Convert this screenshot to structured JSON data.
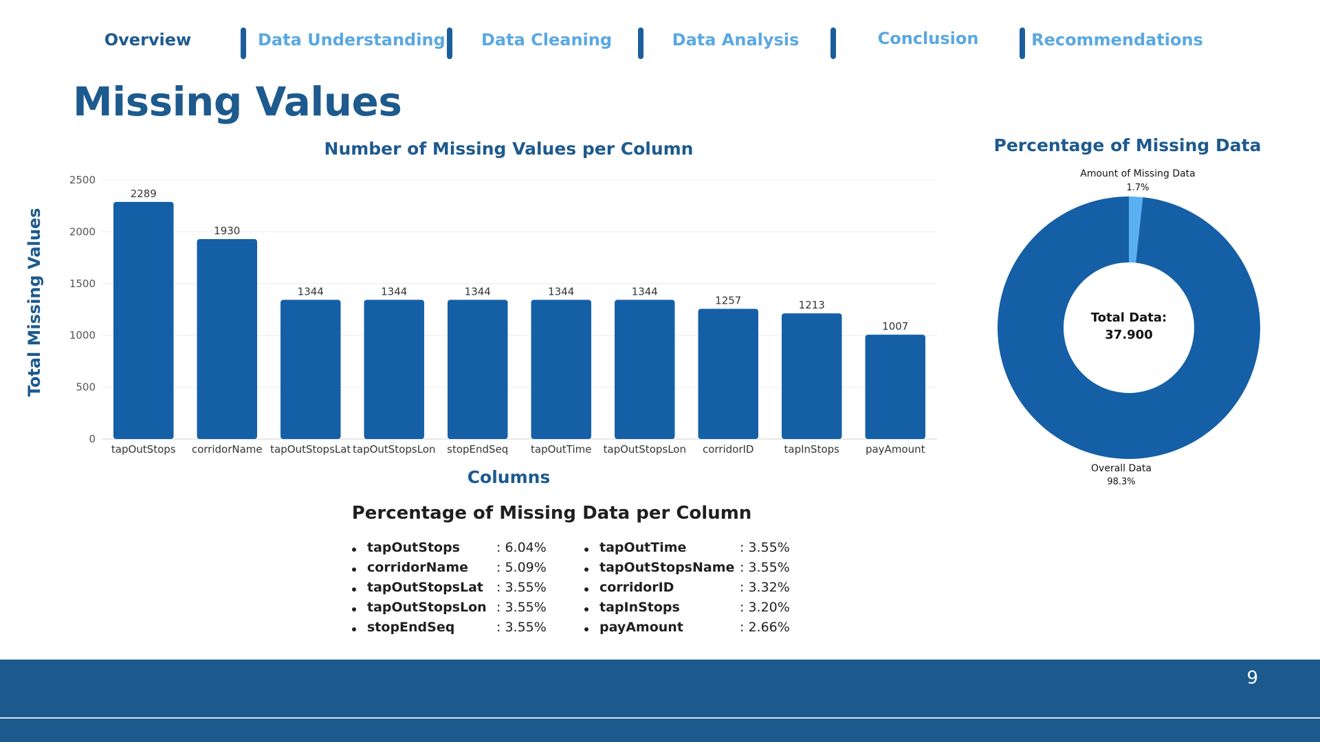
{
  "nav": {
    "items": [
      {
        "label": "Overview",
        "active": true
      },
      {
        "label": "Data Understanding",
        "active": false
      },
      {
        "label": "Data Cleaning",
        "active": false
      },
      {
        "label": "Data Analysis",
        "active": false
      },
      {
        "label": "Conclusion",
        "active": false
      },
      {
        "label": "Recommendations",
        "active": false
      }
    ]
  },
  "page": {
    "title": "Missing Values",
    "page_number": "9"
  },
  "colors": {
    "dark_blue": "#1d5a8e",
    "bar_blue": "#155fa6",
    "light_blue": "#5aa8e0",
    "donut_highlight": "#5ab0f2",
    "footer": "#1c5a8e"
  },
  "chart_data": [
    {
      "type": "bar",
      "title": "Number of Missing Values per Column",
      "xlabel": "Columns",
      "ylabel": "Total Missing Values",
      "categories": [
        "tapOutStops",
        "corridorName",
        "tapOutStopsLat",
        "tapOutStopsLon",
        "stopEndSeq",
        "tapOutTime",
        "tapOutStopsLon",
        "corridorID",
        "tapInStops",
        "payAmount"
      ],
      "values": [
        2289,
        1930,
        1344,
        1344,
        1344,
        1344,
        1344,
        1257,
        1213,
        1007
      ],
      "value_labels": [
        "2289",
        "1930",
        "1344",
        "1344",
        "1344",
        "1344",
        "1344",
        "1257",
        "1213",
        "1007"
      ],
      "ylim": [
        0,
        2500
      ],
      "yticks": [
        "0",
        "500",
        "1000",
        "1500",
        "2000",
        "2500"
      ],
      "grid": true
    },
    {
      "type": "pie",
      "title": "Percentage of Missing Data",
      "slices": [
        {
          "label": "Amount of Missing Data",
          "value": 1.7,
          "value_label": "1.7%"
        },
        {
          "label": "Overall Data",
          "value": 98.3,
          "value_label": "98.3%"
        }
      ],
      "center_label": [
        "Total Data:",
        "37.900"
      ],
      "donut": true
    }
  ],
  "stats": {
    "title": "Percentage of Missing Data per Column",
    "col1": [
      {
        "name": "tapOutStops",
        "value": ": 6.04%"
      },
      {
        "name": "corridorName",
        "value": ": 5.09%"
      },
      {
        "name": "tapOutStopsLat",
        "value": ": 3.55%"
      },
      {
        "name": "tapOutStopsLon",
        "value": ": 3.55%"
      },
      {
        "name": "stopEndSeq",
        "value": ": 3.55%"
      }
    ],
    "col2": [
      {
        "name": "tapOutTime",
        "value": ": 3.55%"
      },
      {
        "name": "tapOutStopsName",
        "value": ": 3.55%"
      },
      {
        "name": "corridorID",
        "value": ": 3.32%"
      },
      {
        "name": "tapInStops",
        "value": ": 3.20%"
      },
      {
        "name": "payAmount",
        "value": ": 2.66%"
      }
    ]
  }
}
